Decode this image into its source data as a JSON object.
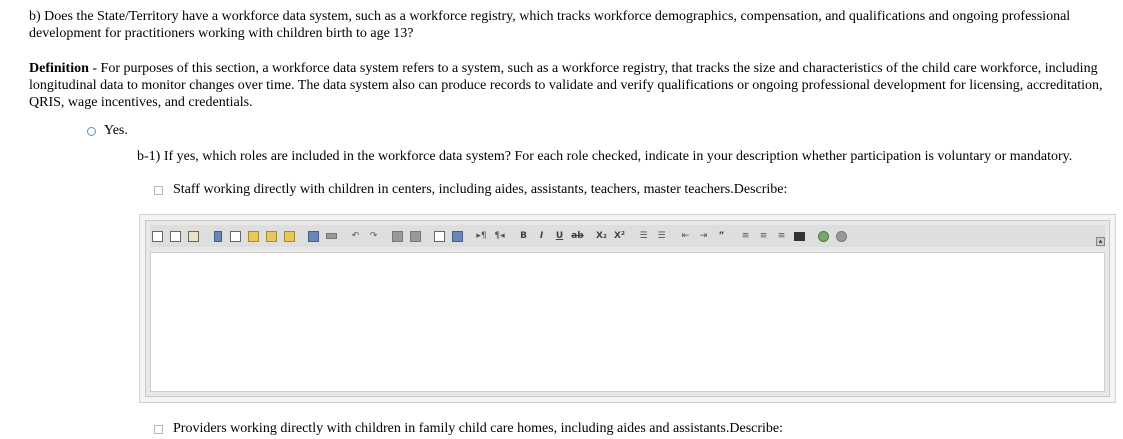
{
  "question": {
    "text": "b) Does the State/Territory have a workforce data system, such as a workforce registry, which tracks workforce demographics, compensation, and qualifications and ongoing professional development for practitioners working with children birth to age 13?"
  },
  "definition": {
    "label": "Definition",
    "text": " - For purposes of this section, a workforce data system refers to a system, such as a workforce registry, that tracks the size and characteristics of the child care workforce, including longitudinal data to monitor changes over time. The data system also can produce records to validate and verify qualifications or ongoing professional development for licensing, accreditation, QRIS, wage incentives, and credentials."
  },
  "yes_option": {
    "label": "Yes.",
    "selected": false
  },
  "subquestion": {
    "text": "b-1) If yes, which roles are included in the workforce data system? For each role checked, indicate in your description whether participation is voluntary or mandatory."
  },
  "roles": [
    {
      "label": "Staff working directly with children in centers, including aides, assistants, teachers, master teachers.Describe:",
      "checked": false
    },
    {
      "label": "Providers working directly with children in family child care homes, including aides and assistants.Describe:",
      "checked": false
    }
  ],
  "editor": {
    "value": "",
    "toolbar_icons": [
      [
        "new-page-icon",
        "preview-icon",
        "templates-icon"
      ],
      [
        "cut-icon",
        "copy-icon",
        "paste-icon",
        "paste-text-icon",
        "paste-word-icon"
      ],
      [
        "print-icon",
        "spellcheck-icon"
      ],
      [
        "undo-icon",
        "redo-icon"
      ],
      [
        "find-icon",
        "replace-icon"
      ],
      [
        "select-all-icon",
        "remove-format-icon"
      ],
      [
        "ltr-icon",
        "rtl-icon"
      ],
      [
        "bold-icon",
        "italic-icon",
        "underline-icon",
        "strike-icon"
      ],
      [
        "subscript-icon",
        "superscript-icon"
      ],
      [
        "numbered-list-icon",
        "bulleted-list-icon"
      ],
      [
        "outdent-icon",
        "indent-icon",
        "blockquote-icon"
      ],
      [
        "align-left-icon",
        "align-center-icon",
        "align-right-icon",
        "justify-icon"
      ],
      [
        "link-icon",
        "unlink-icon"
      ]
    ]
  }
}
